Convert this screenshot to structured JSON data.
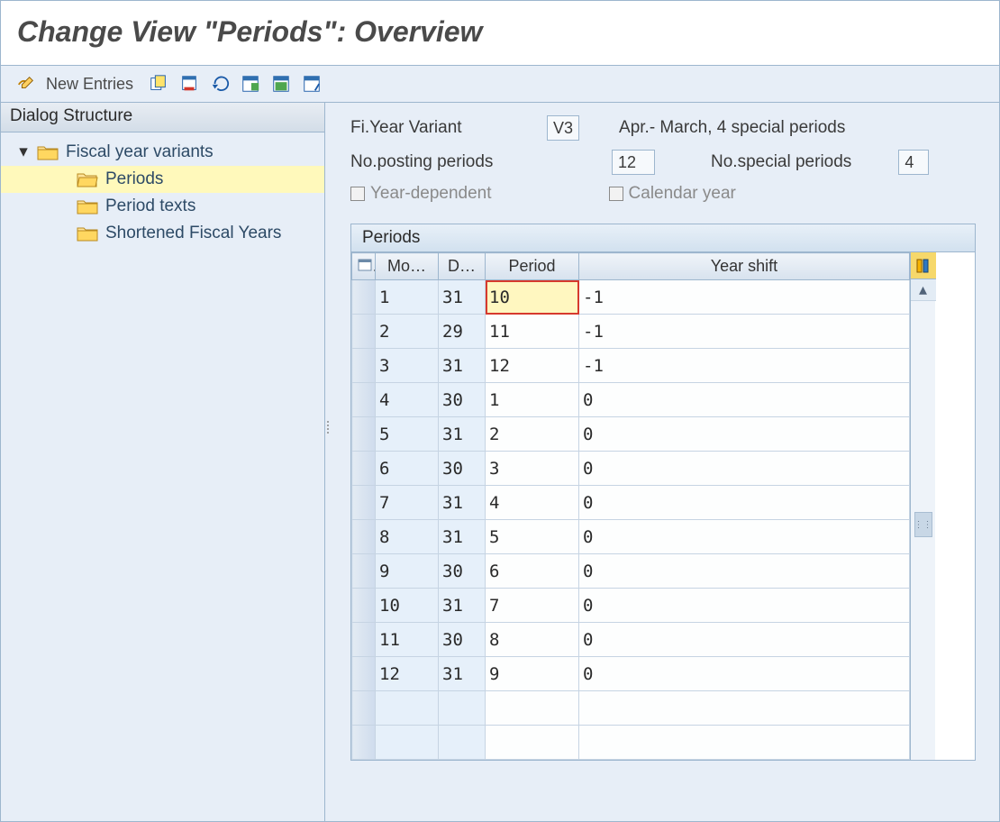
{
  "window": {
    "title": "Change View \"Periods\": Overview"
  },
  "toolbar": {
    "new_entries_label": "New Entries"
  },
  "tree": {
    "header": "Dialog Structure",
    "items": [
      {
        "label": "Fiscal year variants",
        "level": 0,
        "expanded": true,
        "selected": false,
        "folder": "closed"
      },
      {
        "label": "Periods",
        "level": 1,
        "expanded": false,
        "selected": true,
        "folder": "open"
      },
      {
        "label": "Period texts",
        "level": 1,
        "expanded": false,
        "selected": false,
        "folder": "closed"
      },
      {
        "label": "Shortened Fiscal Years",
        "level": 1,
        "expanded": false,
        "selected": false,
        "folder": "closed"
      }
    ]
  },
  "form": {
    "variant_label": "Fi.Year Variant",
    "variant_code": "V3",
    "variant_desc": "Apr.- March, 4 special periods",
    "posting_label": "No.posting periods",
    "posting_value": "12",
    "special_label": "No.special periods",
    "special_value": "4",
    "year_dep_label": "Year-dependent",
    "calendar_label": "Calendar year"
  },
  "grid": {
    "title": "Periods",
    "columns": [
      "Mo…",
      "D…",
      "Period",
      "Year shift"
    ],
    "highlight": {
      "row": 0,
      "col": 2
    },
    "rows": [
      {
        "month": "1",
        "day": "31",
        "period": "10",
        "shift": "-1"
      },
      {
        "month": "2",
        "day": "29",
        "period": "11",
        "shift": "-1"
      },
      {
        "month": "3",
        "day": "31",
        "period": "12",
        "shift": "-1"
      },
      {
        "month": "4",
        "day": "30",
        "period": "1",
        "shift": "0"
      },
      {
        "month": "5",
        "day": "31",
        "period": "2",
        "shift": "0"
      },
      {
        "month": "6",
        "day": "30",
        "period": "3",
        "shift": "0"
      },
      {
        "month": "7",
        "day": "31",
        "period": "4",
        "shift": "0"
      },
      {
        "month": "8",
        "day": "31",
        "period": "5",
        "shift": "0"
      },
      {
        "month": "9",
        "day": "30",
        "period": "6",
        "shift": "0"
      },
      {
        "month": "10",
        "day": "31",
        "period": "7",
        "shift": "0"
      },
      {
        "month": "11",
        "day": "30",
        "period": "8",
        "shift": "0"
      },
      {
        "month": "12",
        "day": "31",
        "period": "9",
        "shift": "0"
      }
    ],
    "empty_rows": 2
  }
}
